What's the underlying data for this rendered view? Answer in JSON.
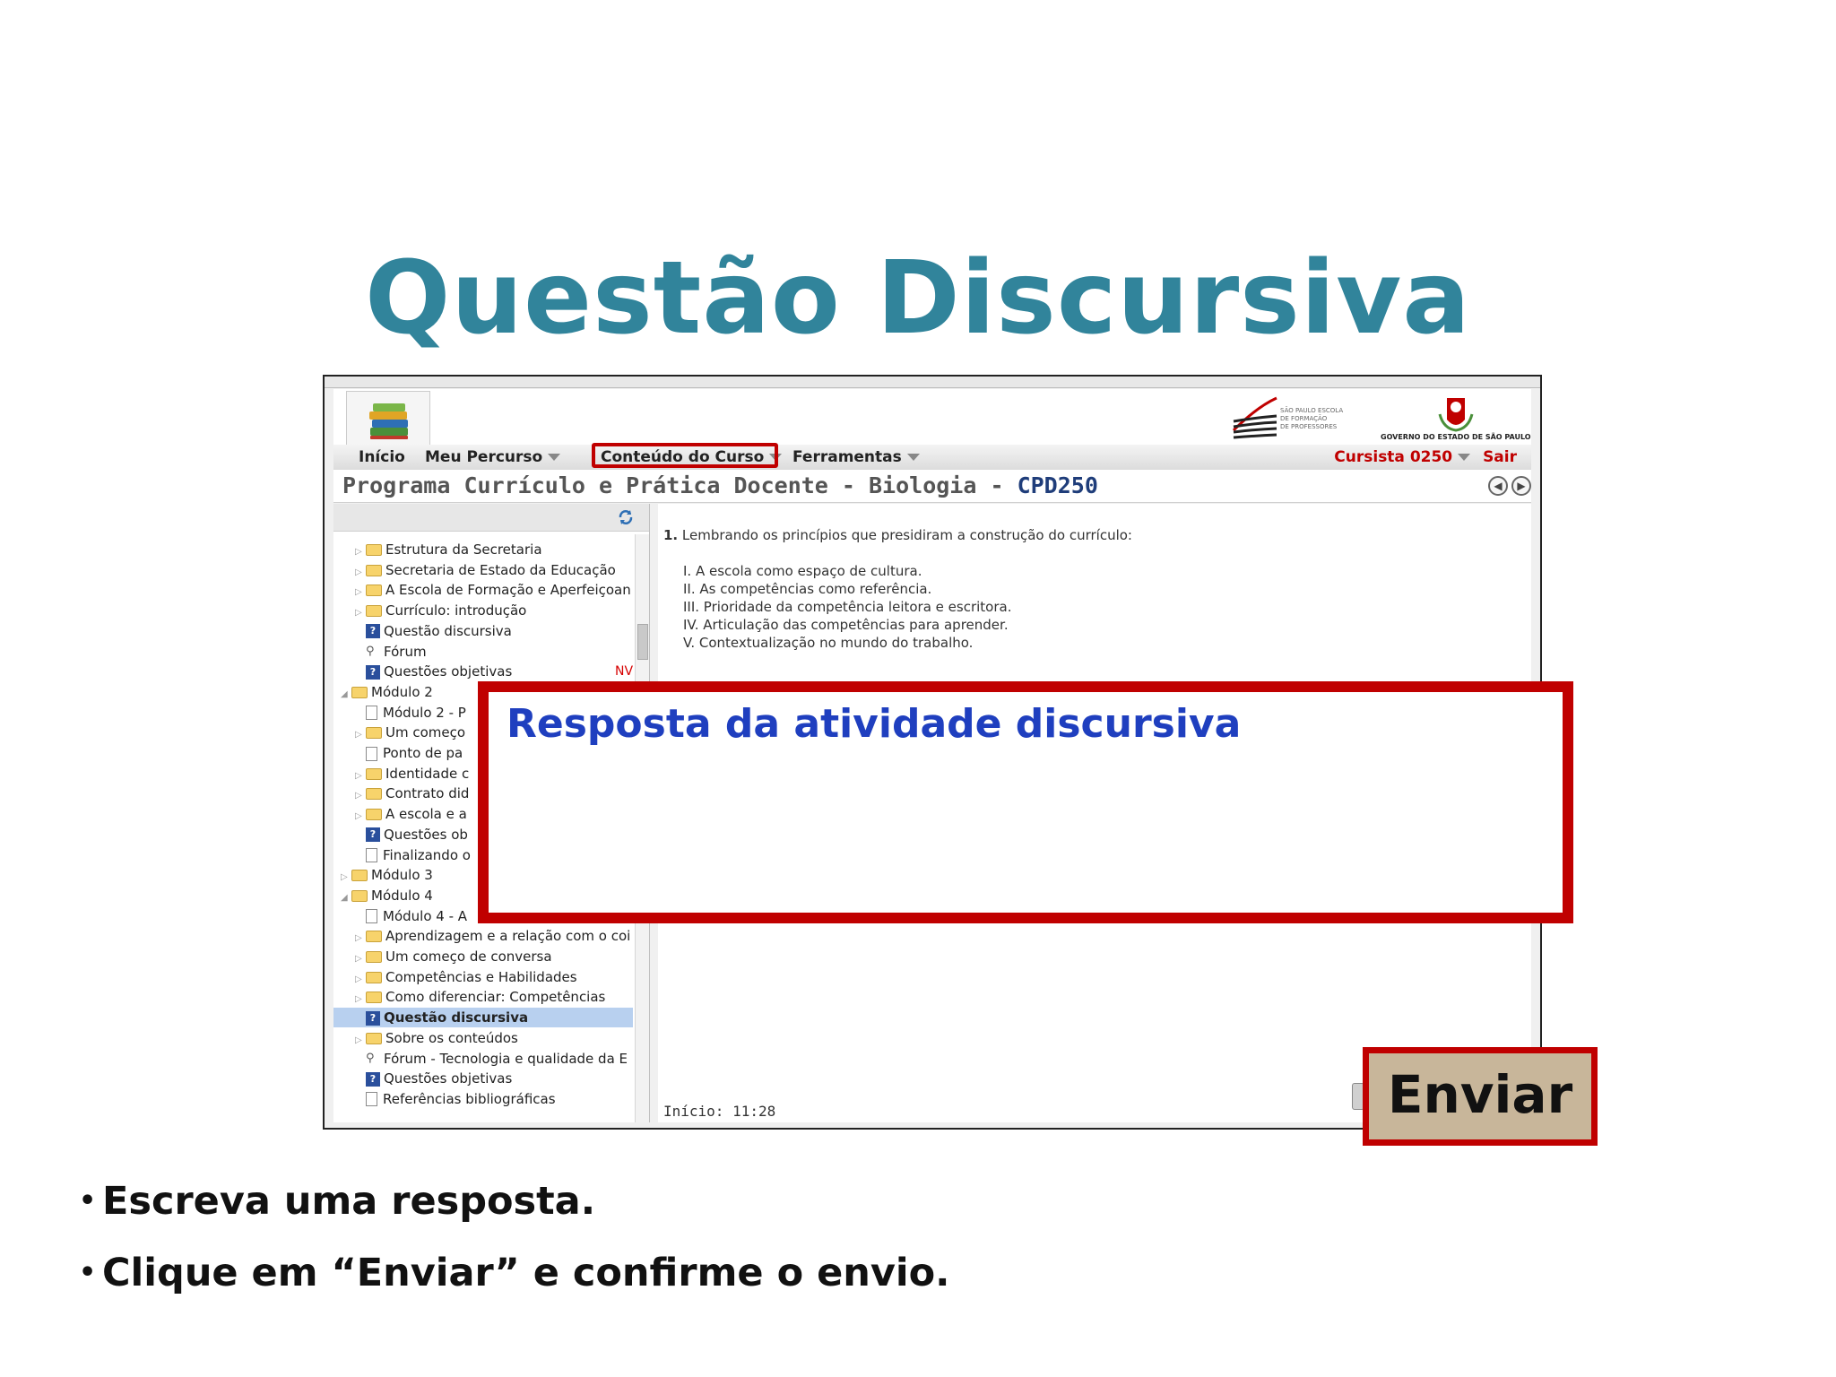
{
  "slide": {
    "title": "Questão Discursiva",
    "bullets": [
      "Escreva uma resposta.",
      "Clique em “Enviar” e confirme o envio."
    ]
  },
  "header": {
    "efap_logo_text": [
      "SÃO PAULO ESCOLA",
      "DE FORMAÇÃO",
      "DE PROFESSORES"
    ],
    "gov_logo_text": "GOVERNO DO ESTADO DE SÃO PAULO"
  },
  "menu": {
    "inicio": "Início",
    "meu_percurso": "Meu Percurso",
    "conteudo_curso": "Conteúdo do Curso",
    "ferramentas": "Ferramentas",
    "user": "Cursista 0250",
    "sair": "Sair"
  },
  "course": {
    "title": "Programa Currículo e Prática Docente - Biologia - ",
    "code": "CPD250"
  },
  "sidebar": {
    "items": [
      {
        "label": "Estrutura da Secretaria",
        "type": "folder",
        "level": 2
      },
      {
        "label": "Secretaria de Estado da Educação",
        "type": "folder",
        "level": 2
      },
      {
        "label": "A Escola de Formação e Aperfeiçoan",
        "type": "folder",
        "level": 2
      },
      {
        "label": "Currículo: introdução",
        "type": "folder",
        "level": 2
      },
      {
        "label": "Questão discursiva",
        "type": "question",
        "level": 2
      },
      {
        "label": "Fórum",
        "type": "forum",
        "level": 2
      },
      {
        "label": "Questões objetivas",
        "type": "question",
        "level": 2,
        "badge": "NV"
      },
      {
        "label": "Módulo 2",
        "type": "folder-open",
        "level": 1
      },
      {
        "label": "Módulo 2 - P",
        "type": "page",
        "level": 2
      },
      {
        "label": "Um começo",
        "type": "folder",
        "level": 2
      },
      {
        "label": "Ponto de pa",
        "type": "page",
        "level": 2
      },
      {
        "label": "Identidade c",
        "type": "folder",
        "level": 2
      },
      {
        "label": "Contrato did",
        "type": "folder",
        "level": 2
      },
      {
        "label": "A escola e a",
        "type": "folder",
        "level": 2
      },
      {
        "label": "Questões ob",
        "type": "question",
        "level": 2
      },
      {
        "label": "Finalizando o",
        "type": "page",
        "level": 2
      },
      {
        "label": "Módulo 3",
        "type": "folder",
        "level": 1
      },
      {
        "label": "Módulo 4",
        "type": "folder-open",
        "level": 1
      },
      {
        "label": "Módulo 4 - A",
        "type": "page",
        "level": 2
      },
      {
        "label": "Aprendizagem e a relação com o coi",
        "type": "folder",
        "level": 2
      },
      {
        "label": "Um começo de conversa",
        "type": "folder",
        "level": 2
      },
      {
        "label": "Competências e Habilidades",
        "type": "folder",
        "level": 2
      },
      {
        "label": "Como diferenciar: Competências",
        "type": "folder",
        "level": 2
      },
      {
        "label": "Questão discursiva",
        "type": "question",
        "level": 2,
        "selected": true
      },
      {
        "label": "Sobre os conteúdos",
        "type": "folder",
        "level": 2
      },
      {
        "label": "Fórum - Tecnologia e qualidade da E",
        "type": "forum",
        "level": 2
      },
      {
        "label": "Questões objetivas",
        "type": "question",
        "level": 2
      },
      {
        "label": "Referências bibliográficas",
        "type": "page",
        "level": 2
      }
    ]
  },
  "content": {
    "question_number": "1.",
    "question_text": "Lembrando os princípios que  presidiram a construção do currículo:",
    "options": [
      "I. A escola como espaço de cultura.",
      "II. As competências como referência.",
      "III. Prioridade da competência leitora e escritora.",
      "IV. Articulação das competências para aprender.",
      "V. Contextualização no mundo do trabalho."
    ],
    "start_time": "Início: 11:28"
  },
  "overlay": {
    "label": "Resposta da atividade discursiva",
    "send_button": "Enviar"
  },
  "colors": {
    "title": "#31849b",
    "highlight": "#c00000",
    "overlay_label": "#1f3fbf",
    "button_bg": "#c8b69a"
  }
}
